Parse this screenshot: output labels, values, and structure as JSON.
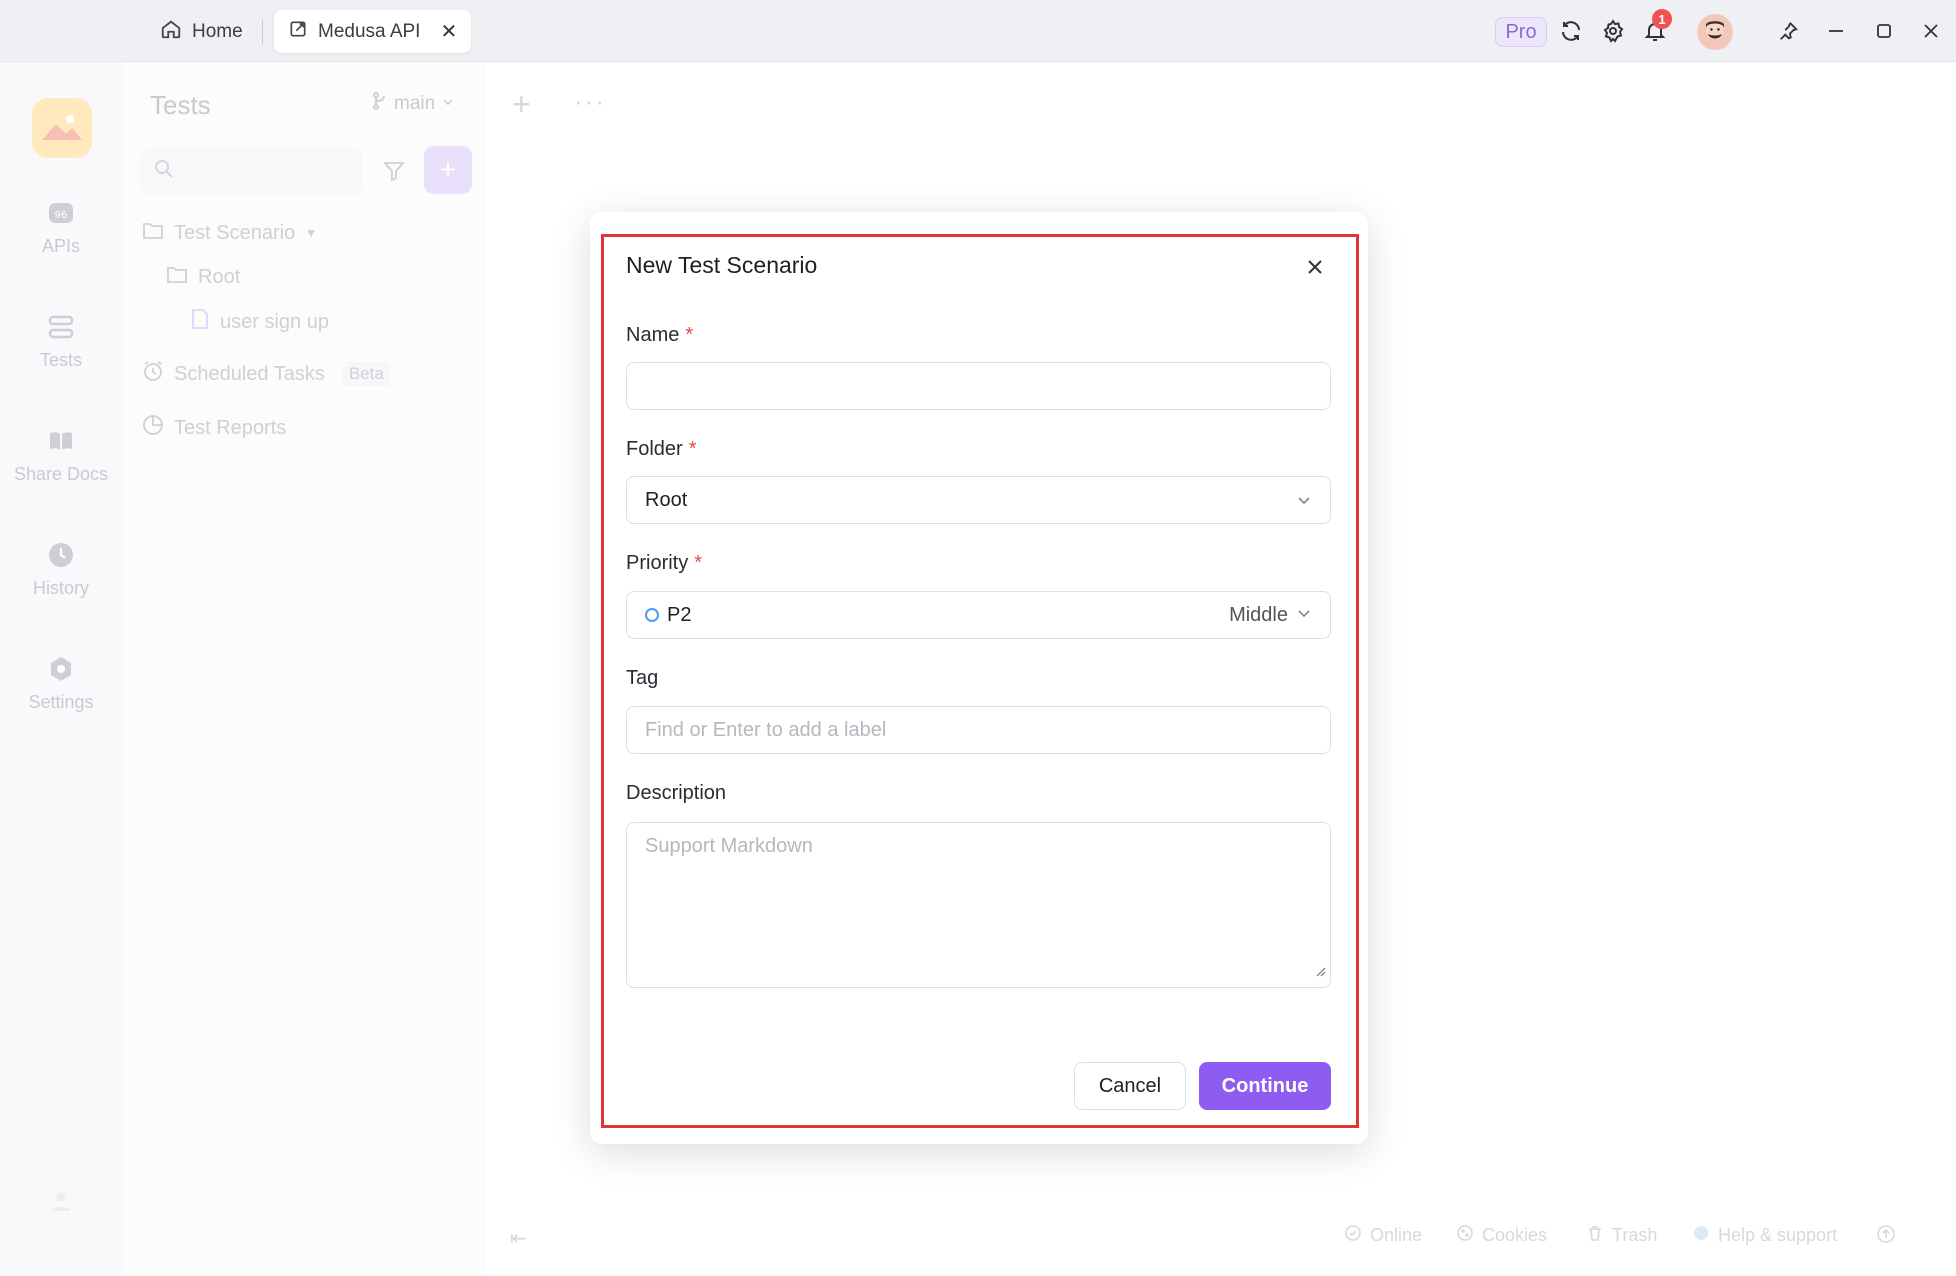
{
  "titlebar": {
    "tabs": [
      {
        "label": "Home",
        "icon": "home-icon"
      },
      {
        "label": "Medusa API",
        "icon": "project-icon"
      }
    ],
    "pro_label": "Pro",
    "notification_count": "1"
  },
  "sidebar": {
    "items": [
      {
        "label": "APIs"
      },
      {
        "label": "Tests"
      },
      {
        "label": "Share Docs"
      },
      {
        "label": "History"
      },
      {
        "label": "Settings"
      }
    ]
  },
  "panel": {
    "title": "Tests",
    "branch": "main",
    "tree": {
      "scenario": "Test Scenario",
      "root": "Root",
      "case": "user sign up",
      "scheduled": "Scheduled Tasks",
      "beta": "Beta",
      "reports": "Test Reports"
    }
  },
  "modal": {
    "title": "New Test Scenario",
    "name_label": "Name",
    "name_value": "",
    "folder_label": "Folder",
    "folder_value": "Root",
    "priority_label": "Priority",
    "priority_code": "P2",
    "priority_level": "Middle",
    "tag_label": "Tag",
    "tag_placeholder": "Find or Enter to add a label",
    "description_label": "Description",
    "description_placeholder": "Support Markdown",
    "cancel_label": "Cancel",
    "continue_label": "Continue",
    "required_mark": "*"
  },
  "statusbar": {
    "online": "Online",
    "cookies": "Cookies",
    "trash": "Trash",
    "help": "Help & support"
  },
  "colors": {
    "accent": "#8e5cf0",
    "highlight": "#e03434",
    "required": "#e5484d"
  }
}
